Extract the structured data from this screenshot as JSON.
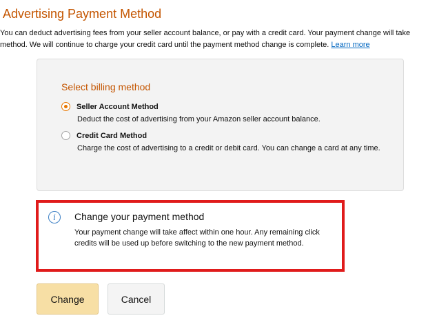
{
  "page": {
    "title": "Advertising Payment Method",
    "intro_line1": "You can deduct advertising fees from your seller account balance, or pay with a credit card. Your payment change will take",
    "intro_line2": "method. We will continue to charge your credit card until the payment method change is complete.",
    "learn_more": "Learn more"
  },
  "billing": {
    "title": "Select billing method",
    "options": [
      {
        "label": "Seller Account Method",
        "description": "Deduct the cost of advertising from your Amazon seller account balance.",
        "selected": true
      },
      {
        "label": "Credit Card Method",
        "description": "Charge the cost of advertising to a credit or debit card. You can change a card at any time.",
        "selected": false
      }
    ]
  },
  "alert": {
    "icon": "info-icon",
    "icon_glyph": "i",
    "title": "Change your payment method",
    "body": "Your payment change will take affect within one hour. Any remaining click credits will be used up before switching to the new payment method."
  },
  "buttons": {
    "change": "Change",
    "cancel": "Cancel"
  },
  "colors": {
    "heading": "#c45500",
    "link": "#0066c0",
    "alert_border": "#e01b1b",
    "primary_button": "#f7dfa5",
    "radio_accent": "#e77600"
  }
}
